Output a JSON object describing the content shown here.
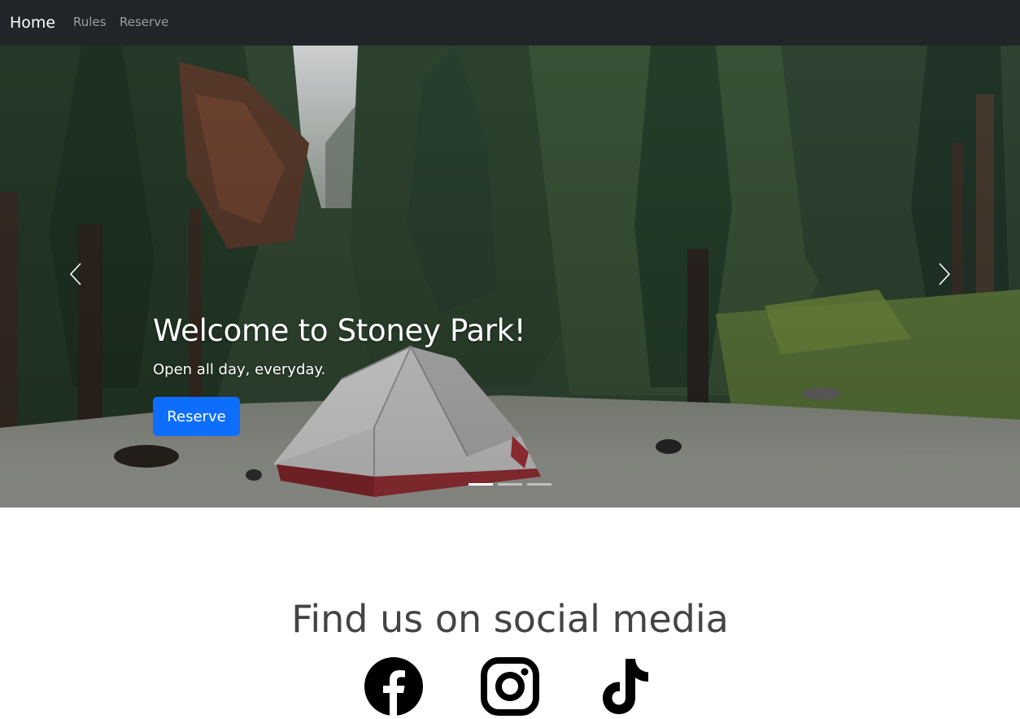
{
  "navbar": {
    "brand": "Home",
    "links": [
      "Rules",
      "Reserve"
    ]
  },
  "hero": {
    "title": "Welcome to Stoney Park!",
    "subtitle": "Open all day, everyday.",
    "button_label": "Reserve",
    "slide_count": 3,
    "active_slide": 1,
    "prev_icon": "chevron-left-icon",
    "next_icon": "chevron-right-icon"
  },
  "social": {
    "heading": "Find us on social media",
    "icons": [
      "facebook-icon",
      "instagram-icon",
      "tiktok-icon"
    ]
  },
  "colors": {
    "navbar_bg": "#212529",
    "primary_button": "#0d6efd",
    "heading_text": "#444444"
  }
}
